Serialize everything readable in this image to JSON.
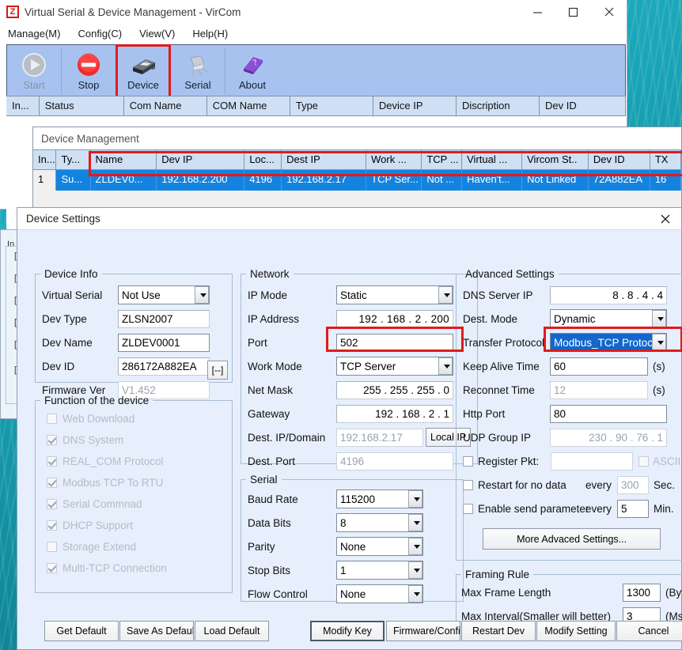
{
  "main_window": {
    "title": "Virtual Serial & Device Management - VirCom",
    "logo_text": "Z",
    "window_controls": {
      "minimize": "minimize-icon",
      "maximize": "maximize-icon",
      "close": "close-icon"
    },
    "menu": [
      {
        "label": "Manage(M)"
      },
      {
        "label": "Config(C)"
      },
      {
        "label": "View(V)"
      },
      {
        "label": "Help(H)"
      }
    ],
    "toolbar": [
      {
        "label": "Start",
        "icon": "play-icon",
        "disabled": true,
        "highlighted": false
      },
      {
        "label": "Stop",
        "icon": "stop-icon",
        "disabled": false,
        "highlighted": false
      },
      {
        "label": "Device",
        "icon": "device-box-icon",
        "disabled": false,
        "highlighted": true
      },
      {
        "label": "Serial",
        "icon": "serial-plug-icon",
        "disabled": false,
        "highlighted": false
      },
      {
        "label": "About",
        "icon": "about-book-icon",
        "disabled": false,
        "highlighted": false
      }
    ],
    "device_list_columns": [
      "In...",
      "Status",
      "Com Name",
      "COM Name",
      "Type",
      "Device IP",
      "Discription",
      "Dev ID"
    ]
  },
  "device_management": {
    "title": "Device Management",
    "columns": [
      "In...",
      "Ty...",
      "Name",
      "Dev IP",
      "Loc...",
      "Dest IP",
      "Work ...",
      "TCP ...",
      "Virtual ...",
      "Vircom St..",
      "Dev ID",
      "TX"
    ],
    "rows": [
      {
        "index": "1",
        "type": "Su...",
        "name": "ZLDEV0...",
        "dev_ip": "192.168.2.200",
        "local_port": "4196",
        "dest_ip": "192.168.2.17",
        "work_mode": "TCP Ser...",
        "tcp": "Not ...",
        "virtual": "Haven't...",
        "vircom_status": "Not Linked",
        "dev_id": "72A882EA",
        "tx": "16"
      }
    ]
  },
  "dialog": {
    "title": "Device Settings",
    "close_icon": "close-icon",
    "device_info": {
      "legend": "Device Info",
      "virtual_serial": {
        "label": "Virtual Serial",
        "value": "Not Use"
      },
      "dev_type": {
        "label": "Dev Type",
        "value": "ZLSN2007"
      },
      "dev_name": {
        "label": "Dev Name",
        "value": "ZLDEV0001"
      },
      "dev_id": {
        "label": "Dev ID",
        "value": "286172A882EA",
        "button": "[--]"
      },
      "firmware_ver": {
        "label": "Firmware Ver",
        "value": "V1.452"
      }
    },
    "functions": {
      "legend": "Function of the device",
      "items": [
        {
          "label": "Web Download",
          "checked": false
        },
        {
          "label": "DNS System",
          "checked": true
        },
        {
          "label": "REAL_COM Protocol",
          "checked": true
        },
        {
          "label": "Modbus TCP To RTU",
          "checked": true
        },
        {
          "label": "Serial Commnad",
          "checked": true
        },
        {
          "label": "DHCP Support",
          "checked": true
        },
        {
          "label": "Storage Extend",
          "checked": false
        },
        {
          "label": "Multi-TCP Connection",
          "checked": true
        }
      ]
    },
    "network": {
      "legend": "Network",
      "ip_mode": {
        "label": "IP Mode",
        "value": "Static"
      },
      "ip_address": {
        "label": "IP Address",
        "value": "192 . 168 .  2  . 200"
      },
      "port": {
        "label": "Port",
        "value": "502",
        "highlighted": true
      },
      "work_mode": {
        "label": "Work Mode",
        "value": "TCP Server"
      },
      "net_mask": {
        "label": "Net Mask",
        "value": "255 . 255 . 255 .  0"
      },
      "gateway": {
        "label": "Gateway",
        "value": "192 . 168 .  2  .  1"
      },
      "dest_ip": {
        "label": "Dest. IP/Domain",
        "value": "192.168.2.17",
        "button": "Local IP"
      },
      "dest_port": {
        "label": "Dest. Port",
        "value": "4196"
      }
    },
    "serial": {
      "legend": "Serial",
      "baud_rate": {
        "label": "Baud Rate",
        "value": "115200"
      },
      "data_bits": {
        "label": "Data Bits",
        "value": "8"
      },
      "parity": {
        "label": "Parity",
        "value": "None"
      },
      "stop_bits": {
        "label": "Stop Bits",
        "value": "1"
      },
      "flow_control": {
        "label": "Flow Control",
        "value": "None"
      }
    },
    "advanced": {
      "legend": "Advanced Settings",
      "dns_server_ip": {
        "label": "DNS Server IP",
        "value": " 8  .  8  .  4  .  4"
      },
      "dest_mode": {
        "label": "Dest. Mode",
        "value": "Dynamic"
      },
      "transfer_protocol": {
        "label": "Transfer Protocol",
        "value": "Modbus_TCP Protocol",
        "highlighted": true,
        "selected": true
      },
      "keep_alive_time": {
        "label": "Keep Alive Time",
        "value": "60",
        "unit": "(s)"
      },
      "reconnet_time": {
        "label": "Reconnet Time",
        "value": "12",
        "unit": "(s)"
      },
      "http_port": {
        "label": "Http Port",
        "value": "80"
      },
      "udp_group_ip": {
        "label": "UDP Group IP",
        "value": "230 . 90 . 76 .  1"
      },
      "register_pkt": {
        "label": "Register Pkt:",
        "value": "",
        "checked": false,
        "ascii_label": "ASCII",
        "ascii_checked": false
      },
      "restart_no_data": {
        "label": "Restart for no data",
        "checked": false,
        "every_label": "every",
        "value": "300",
        "unit": "Sec."
      },
      "enable_send_param": {
        "label": "Enable send parameter",
        "checked": false,
        "every_label": "every",
        "value": "5",
        "unit": "Min."
      },
      "more_button": "More Advaced Settings..."
    },
    "framing_rule": {
      "legend": "Framing Rule",
      "max_frame_length": {
        "label": "Max Frame Length",
        "value": "1300",
        "unit": "(Byte)"
      },
      "max_interval": {
        "label": "Max Interval(Smaller will better)",
        "value": "3",
        "unit": "(Ms)"
      }
    },
    "buttons": {
      "get_default": "Get Default",
      "save_as_default": "Save As Default",
      "load_default": "Load Default",
      "modify_key": "Modify Key",
      "firmware_config": "Firmware/Config",
      "restart_dev": "Restart Dev",
      "modify_setting": "Modify Setting",
      "cancel": "Cancel"
    }
  },
  "colors": {
    "toolbar_bg": "#a7c2ef",
    "dialog_bg": "#e6effb",
    "grid_header": "#cfe0f4",
    "row_selected": "#1383e0",
    "annotation_red": "#e01b1b",
    "desktop_teal": "#19a3b6",
    "combo_selected": "#1366cc"
  }
}
